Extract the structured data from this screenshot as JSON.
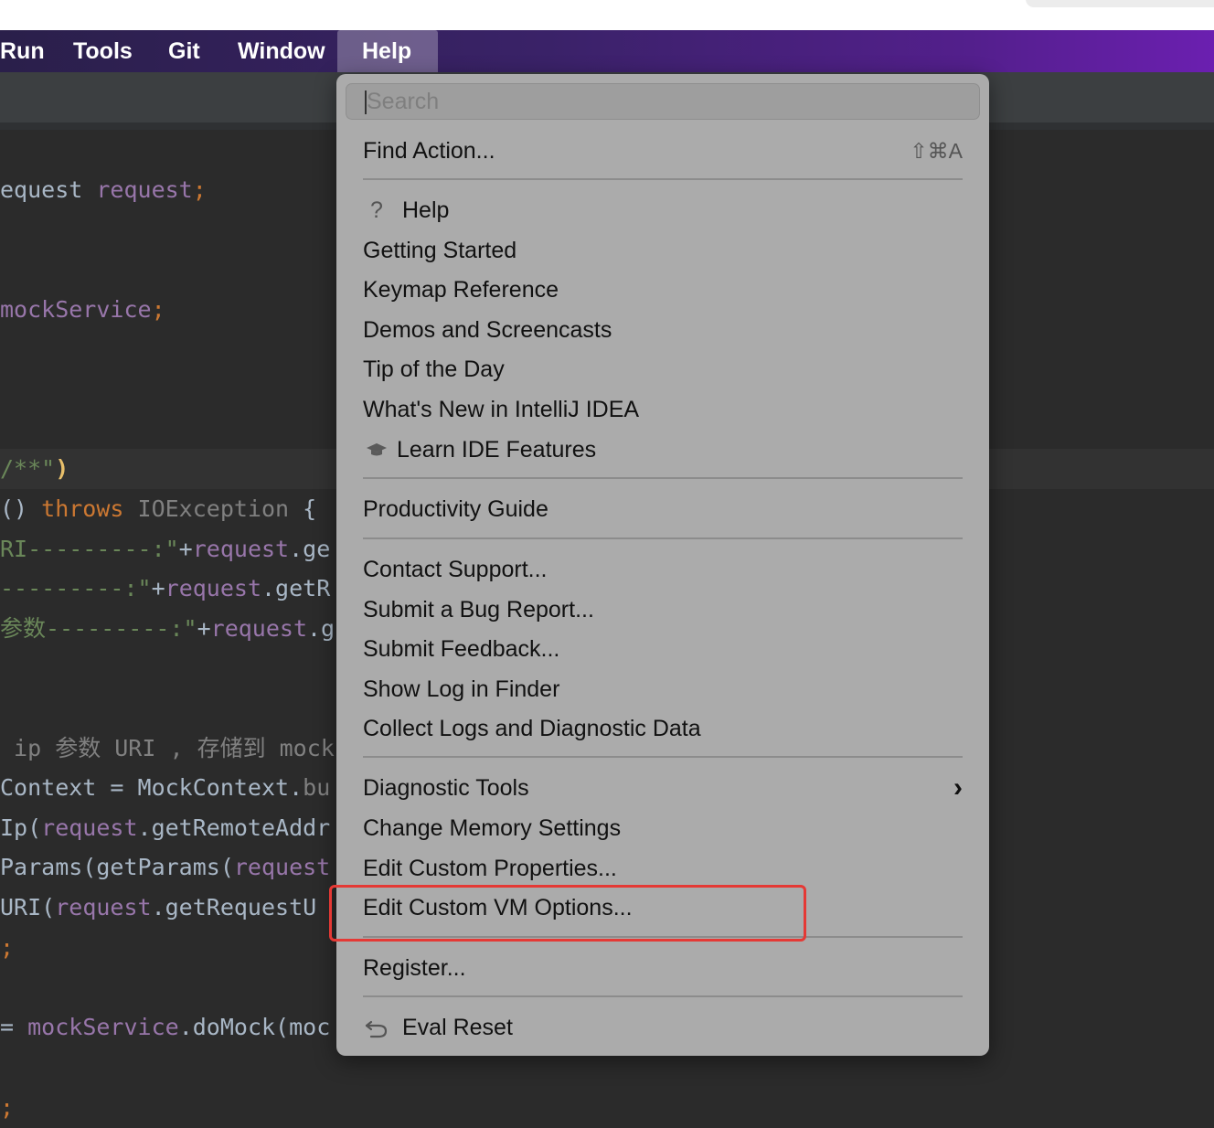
{
  "menubar": {
    "items": [
      "Run",
      "Tools",
      "Git",
      "Window",
      "Help"
    ],
    "active": "Help"
  },
  "code_lines": [
    [
      [
        "equest ",
        "plain"
      ],
      [
        "request",
        "field"
      ],
      [
        ";",
        "punct"
      ]
    ],
    [
      [
        "mockService",
        "field"
      ],
      [
        ";",
        "punct"
      ]
    ],
    [
      [
        "/**",
        "str"
      ],
      [
        "\"",
        "str"
      ],
      [
        ")",
        "paren"
      ]
    ],
    [
      [
        "() ",
        "plain"
      ],
      [
        "throws ",
        "kw"
      ],
      [
        "IOException",
        "comment"
      ],
      [
        " {",
        "plain"
      ]
    ],
    [
      [
        "RI---------:\"",
        "str"
      ],
      [
        "+",
        "plain"
      ],
      [
        "request",
        "field"
      ],
      [
        ".ge",
        "plain"
      ]
    ],
    [
      [
        "---------:\"",
        "str"
      ],
      [
        "+",
        "plain"
      ],
      [
        "request",
        "field"
      ],
      [
        ".getR",
        "plain"
      ]
    ],
    [
      [
        "参数---------:\"",
        "str"
      ],
      [
        "+",
        "plain"
      ],
      [
        "request",
        "field"
      ],
      [
        ".g",
        "plain"
      ]
    ],
    [
      [
        " ip 参数 URI , 存储到 mock",
        "comment"
      ]
    ],
    [
      [
        "Context = MockContext.",
        "plain"
      ],
      [
        "bu",
        "comment"
      ]
    ],
    [
      [
        "Ip(",
        "plain"
      ],
      [
        "request",
        "field"
      ],
      [
        ".getRemoteAddr",
        "plain"
      ]
    ],
    [
      [
        "Params(getParams(",
        "plain"
      ],
      [
        "request",
        "field"
      ]
    ],
    [
      [
        "URI(",
        "plain"
      ],
      [
        "request",
        "field"
      ],
      [
        ".getRequestU",
        "plain"
      ]
    ],
    [
      [
        ";",
        "punct"
      ]
    ],
    [
      [
        "= ",
        "plain"
      ],
      [
        "mockService",
        "field"
      ],
      [
        ".doMock(moc",
        "plain"
      ]
    ],
    [
      [
        ";",
        "punct"
      ]
    ]
  ],
  "help_menu": {
    "search_placeholder": "Search",
    "find_action": {
      "label": "Find Action...",
      "shortcut": "⇧⌘A"
    },
    "help": "Help",
    "getting_started": "Getting Started",
    "keymap_reference": "Keymap Reference",
    "demos": "Demos and Screencasts",
    "tip_of_day": "Tip of the Day",
    "whats_new": "What's New in IntelliJ IDEA",
    "learn_ide": "Learn IDE Features",
    "productivity_guide": "Productivity Guide",
    "contact_support": "Contact Support...",
    "submit_bug": "Submit a Bug Report...",
    "submit_feedback": "Submit Feedback...",
    "show_log": "Show Log in Finder",
    "collect_logs": "Collect Logs and Diagnostic Data",
    "diagnostic_tools": "Diagnostic Tools",
    "change_memory": "Change Memory Settings",
    "edit_properties": "Edit Custom Properties...",
    "edit_vm_options": "Edit Custom VM Options...",
    "register": "Register...",
    "eval_reset": "Eval Reset"
  },
  "colors": {
    "highlight_border": "#e53935",
    "menu_background": "#ababab"
  }
}
